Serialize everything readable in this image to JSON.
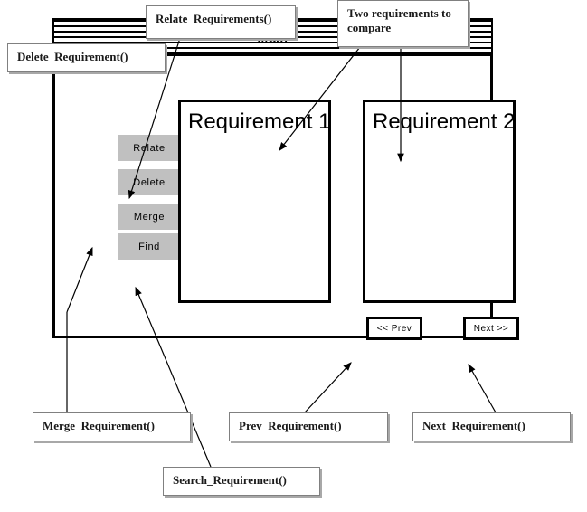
{
  "window": {
    "title": "Main",
    "sidebar": {
      "buttons": [
        {
          "label": "Relate",
          "name": "relate-button"
        },
        {
          "label": "Delete",
          "name": "delete-button"
        },
        {
          "label": "Merge",
          "name": "merge-button"
        },
        {
          "label": "Find",
          "name": "find-button"
        }
      ]
    },
    "panels": [
      {
        "title": "Requirement 1"
      },
      {
        "title": "Requirement 2"
      }
    ],
    "navigation": {
      "prev_label": "<< Prev",
      "next_label": "Next >>"
    }
  },
  "annotations": [
    {
      "id": "delete",
      "text": "Delete_Requirement()"
    },
    {
      "id": "relate",
      "text": "Relate_Requirements()"
    },
    {
      "id": "two_req",
      "text": "Two requirements to compare"
    },
    {
      "id": "merge",
      "text": "Merge_Requirement()"
    },
    {
      "id": "prev",
      "text": "Prev_Requirement()"
    },
    {
      "id": "next",
      "text": "Next_Requirement()"
    },
    {
      "id": "search",
      "text": "Search_Requirement()"
    }
  ],
  "colors": {
    "button_face": "#c0c0c0",
    "border": "#000000",
    "callout_border": "#808080",
    "page_background": "#ffffff",
    "text": "#000000"
  }
}
